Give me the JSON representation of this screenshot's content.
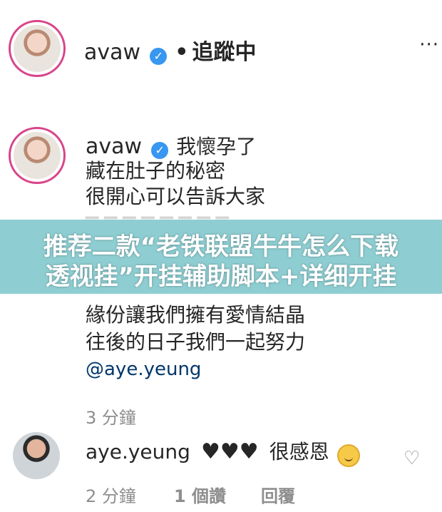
{
  "header": {
    "username": "avaw",
    "separator": "•",
    "follow_status": "追蹤中",
    "more_icon_glyph": "···"
  },
  "post": {
    "username": "avaw",
    "caption_lines": [
      "我懷孕了",
      "藏在肚子的秘密",
      "很開心可以告訴大家"
    ],
    "caption_lines_after": [
      "緣份讓我們擁有愛情結晶",
      "往後的日子我們一起努力"
    ],
    "mention": "@aye.yeung",
    "timestamp": "3 分鐘"
  },
  "banner": {
    "line1": "推荐二款“老铁联盟牛牛怎么下载",
    "line2": "透视挂”开挂辅助脚本+详细开挂"
  },
  "comment": {
    "username": "aye.yeung",
    "hearts": "♥♥♥",
    "text": "很感恩",
    "time": "2 分鐘",
    "likes": "1 個讚",
    "reply": "回覆"
  },
  "icons": {
    "verified": "verified-badge-icon",
    "more": "more-options-icon",
    "like": "heart-outline-icon",
    "emoji": "smiling-emoji-icon"
  },
  "colors": {
    "verified_blue": "#3897f0",
    "mention": "#00376b",
    "avatar_ring": "#d8458a",
    "banner_bg": "#7ec7cc",
    "muted": "#8e8e8e"
  }
}
